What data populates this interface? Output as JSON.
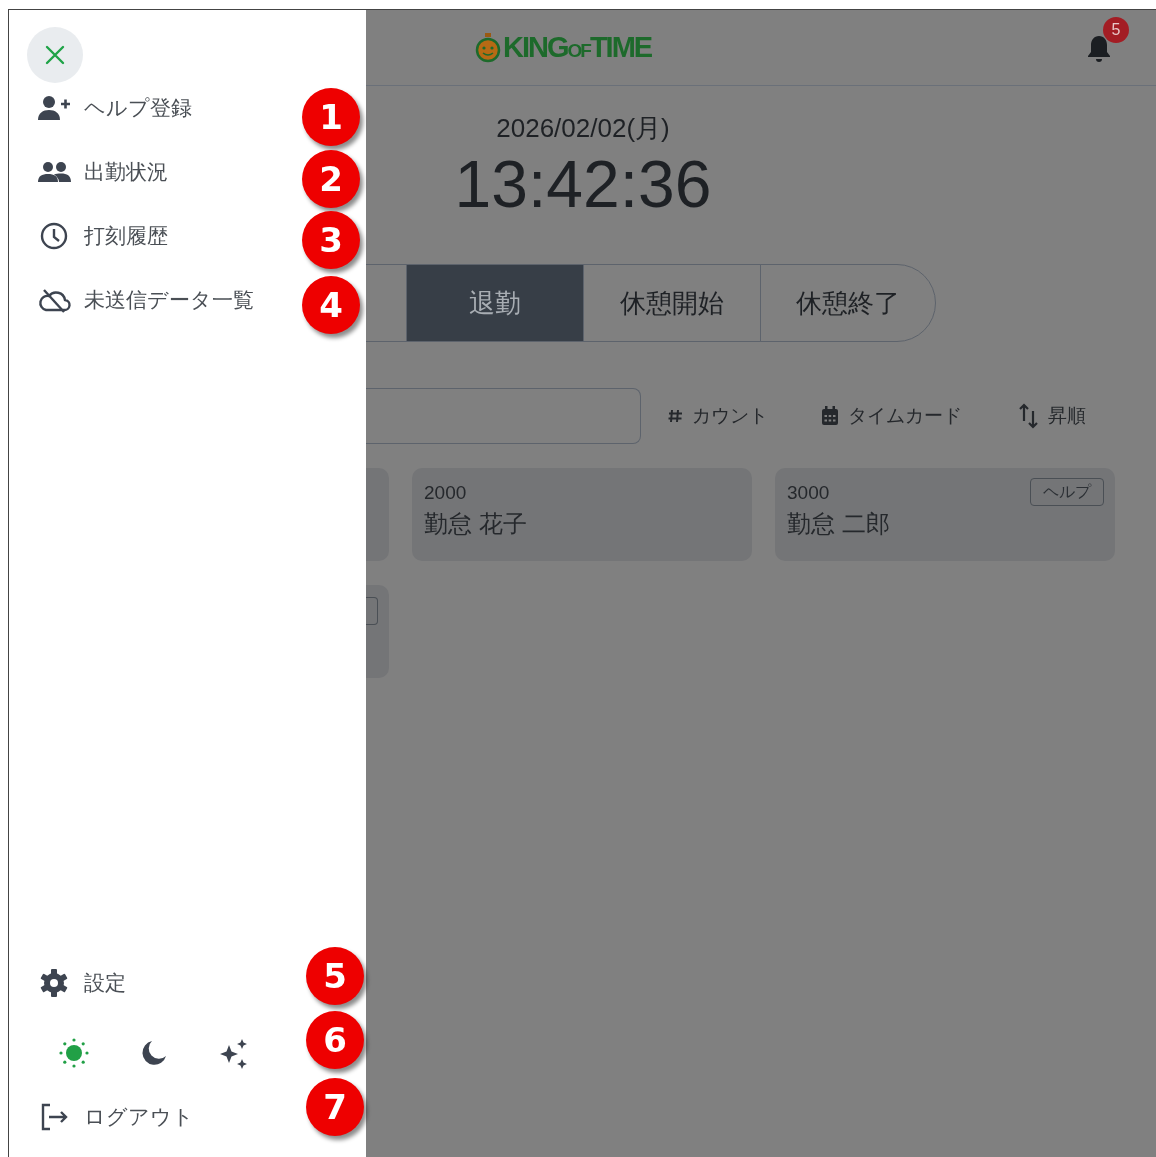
{
  "drawer": {
    "menu": [
      {
        "label": "ヘルプ登録"
      },
      {
        "label": "出勤状況"
      },
      {
        "label": "打刻履歴"
      },
      {
        "label": "未送信データ一覧"
      }
    ],
    "settings": {
      "label": "設定"
    },
    "themes": [
      {
        "selected": true
      },
      {
        "selected": false
      },
      {
        "selected": false
      }
    ],
    "logout": {
      "label": "ログアウト"
    }
  },
  "header": {
    "logo": [
      "KING",
      "OF",
      "TIME"
    ],
    "notification_count": "5"
  },
  "date": "2026/02/02(月)",
  "time": "13:42:36",
  "punch_buttons": [
    {
      "label": "退勤",
      "selected": true
    },
    {
      "label": "休憩開始",
      "selected": false
    },
    {
      "label": "休憩終了",
      "selected": false
    }
  ],
  "toolbar": [
    {
      "label": "カウント"
    },
    {
      "label": "タイムカード"
    },
    {
      "label": "昇順"
    }
  ],
  "employees": [
    {
      "code": "2000",
      "name": "勤怠 花子"
    },
    {
      "code": "3000",
      "name": "勤怠 二郎",
      "badge": "ヘルプ"
    }
  ],
  "callouts": [
    "1",
    "2",
    "3",
    "4",
    "5",
    "6",
    "7"
  ]
}
